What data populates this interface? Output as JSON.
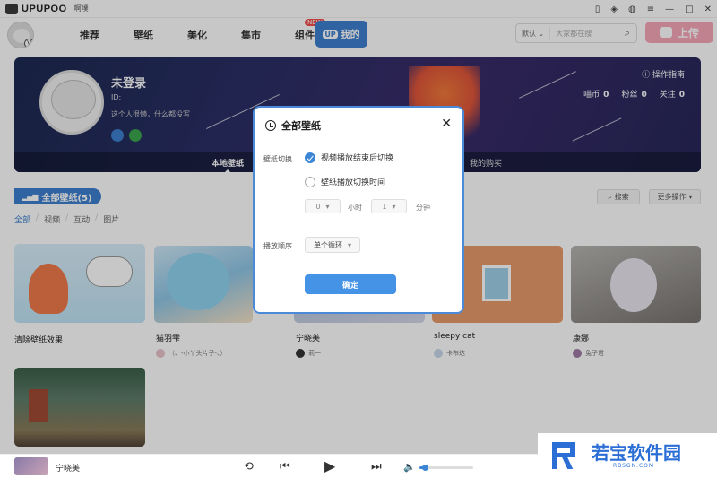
{
  "app": {
    "logo_text": "UPUPOO",
    "beta_label": "啊噗"
  },
  "nav": {
    "items": [
      {
        "label": "推荐"
      },
      {
        "label": "壁纸"
      },
      {
        "label": "美化"
      },
      {
        "label": "集市"
      },
      {
        "label": "组件"
      }
    ],
    "new_badge": "NEW",
    "my_up": {
      "badge": "UP",
      "label": "我的"
    },
    "search": {
      "scope": "默认",
      "placeholder": "大家都在搜"
    },
    "upload_label": "上传"
  },
  "profile": {
    "name": "未登录",
    "id_label": "ID:",
    "signature": "这个人很懒，什么都没写",
    "guide_label": "操作指南",
    "stats": [
      {
        "label": "喵币",
        "value": "0"
      },
      {
        "label": "粉丝",
        "value": "0"
      },
      {
        "label": "关注",
        "value": "0"
      }
    ],
    "tabs": {
      "local": "本地壁纸",
      "purchases": "我的购买"
    }
  },
  "section": {
    "title": "全部壁纸(5)",
    "filters": [
      "全部",
      "视频",
      "互动",
      "图片"
    ],
    "search_label": "搜索",
    "more_label": "更多操作"
  },
  "cards": [
    {
      "title": "清除壁纸效果",
      "user": ""
    },
    {
      "title": "猫羽雫",
      "user": "（、-小丫头片子-、）"
    },
    {
      "title": "宁晓美",
      "user": "莉一"
    },
    {
      "title": "sleepy cat",
      "user": "卡布达"
    },
    {
      "title": "康娜",
      "user": "兔子君"
    },
    {
      "title": "",
      "user": ""
    }
  ],
  "modal": {
    "title": "全部壁纸",
    "switch_label": "壁纸切换",
    "option_video_end": "视频播放结束后切换",
    "option_timer": "壁纸播放切换时间",
    "hours_value": "0",
    "hours_unit": "小时",
    "minutes_value": "1",
    "minutes_unit": "分钟",
    "order_label": "播放顺序",
    "order_value": "单个循环",
    "confirm_label": "确定"
  },
  "player": {
    "title": "宁晓美",
    "volume": 0.1
  },
  "watermark": {
    "text": "若宝软件园",
    "sub": "RBSGN.COM"
  }
}
